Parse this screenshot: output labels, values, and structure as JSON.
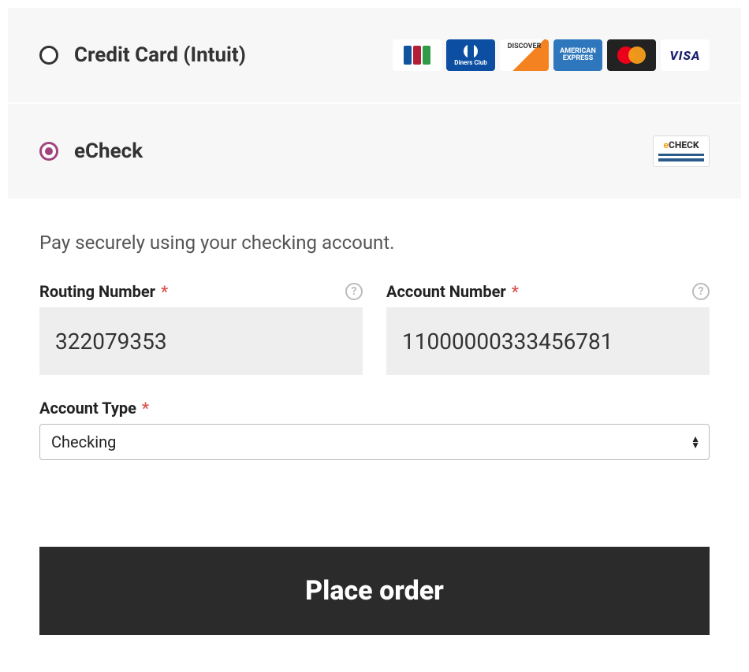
{
  "payment_methods": {
    "credit_card": {
      "label": "Credit Card (Intuit)",
      "selected": false,
      "accepted_cards": [
        "jcb",
        "diners",
        "discover",
        "amex",
        "mastercard",
        "visa"
      ]
    },
    "echeck": {
      "label": "eCheck",
      "selected": true
    }
  },
  "form": {
    "description": "Pay securely using your checking account.",
    "routing": {
      "label": "Routing Number",
      "required_mark": "*",
      "value": "322079353"
    },
    "account": {
      "label": "Account Number",
      "required_mark": "*",
      "value": "11000000333456781"
    },
    "account_type": {
      "label": "Account Type",
      "required_mark": "*",
      "selected": "Checking"
    }
  },
  "actions": {
    "place_order": "Place order"
  },
  "help_glyph": "?"
}
